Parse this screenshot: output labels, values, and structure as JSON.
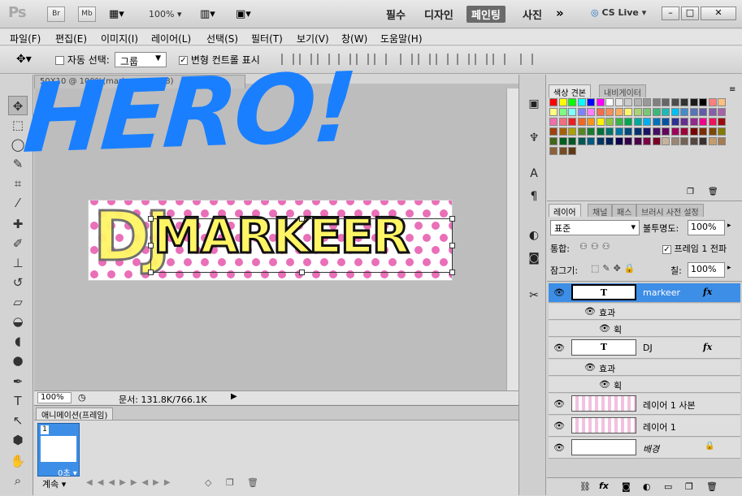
{
  "app": {
    "logo": "Ps",
    "btn_br": "Br",
    "btn_mb": "Mb",
    "zoom": "100%",
    "ws_essentials": "필수",
    "ws_design": "디자인",
    "ws_painting": "페인팅",
    "ws_photo": "사진",
    "cslive": "CS Live"
  },
  "menu": [
    "파일(F)",
    "편집(E)",
    "이미지(I)",
    "레이어(L)",
    "선택(S)",
    "필터(T)",
    "보기(V)",
    "창(W)",
    "도움말(H)"
  ],
  "options": {
    "auto_select": "자동 선택:",
    "auto_value": "그룹",
    "transform": "변형 컨트롤 표시"
  },
  "document": {
    "tab": "50X10 @ 100%(markeer, RGB/8)",
    "hero_text": "HERO!",
    "banner_dj": "DJ",
    "banner_text": "MARKEER"
  },
  "status": {
    "zoom": "100%",
    "doc_info": "문서: 131.8K/766.1K"
  },
  "animation": {
    "title": "애니메이션(프레임)",
    "frame_number": "1",
    "frame_time": "0초",
    "loop": "계속"
  },
  "swatches": {
    "tab1": "색상 견본",
    "tab2": "내비게이터"
  },
  "layers": {
    "tabs": [
      "레이어",
      "채널",
      "패스",
      "브러시 사전 설정"
    ],
    "blend_mode": "표준",
    "opacity_label": "불투명도:",
    "opacity": "100%",
    "unify_label": "통합:",
    "propagate": "프레임 1 전파",
    "lock_label": "잠그기:",
    "fill_label": "칠:",
    "fill": "100%",
    "items": [
      {
        "name": "markeer",
        "thumb": "T",
        "fx": "fx",
        "effect": "효과",
        "stroke": "획"
      },
      {
        "name": "DJ",
        "thumb": "T",
        "fx": "fx",
        "effect": "효과",
        "stroke": "획"
      },
      {
        "name": "레이어 1 사본"
      },
      {
        "name": "레이어 1"
      },
      {
        "name": "배경"
      }
    ]
  },
  "colors": {
    "accent": "#1a7fff",
    "selected_layer": "#3d8ee6",
    "dot": "#e96fb8",
    "banner_text": "#fff565"
  }
}
